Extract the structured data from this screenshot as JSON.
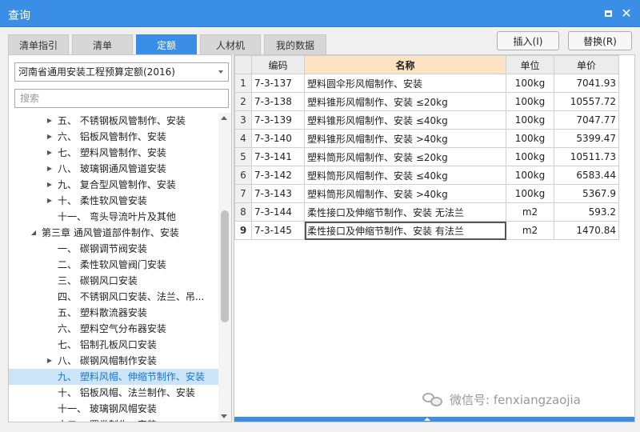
{
  "window": {
    "title": "查询"
  },
  "tabs": [
    {
      "label": "清单指引",
      "active": false
    },
    {
      "label": "清单",
      "active": false
    },
    {
      "label": "定额",
      "active": true
    },
    {
      "label": "人材机",
      "active": false
    },
    {
      "label": "我的数据",
      "active": false
    }
  ],
  "toolbar": {
    "insert_label": "插入(I)",
    "replace_label": "替换(R)"
  },
  "library": {
    "selected": "河南省通用安装工程预算定额(2016)"
  },
  "search": {
    "placeholder": "搜索",
    "value": ""
  },
  "tree": [
    {
      "label": "五、 不锈钢板风管制作、安装",
      "expander": true,
      "level": 3
    },
    {
      "label": "六、 铝板风管制作、安装",
      "expander": true,
      "level": 3
    },
    {
      "label": "七、 塑料风管制作、安装",
      "expander": true,
      "level": 3
    },
    {
      "label": "八、 玻璃钢通风管道安装",
      "expander": true,
      "level": 3
    },
    {
      "label": "九、 复合型风管制作、安装",
      "expander": true,
      "level": 3
    },
    {
      "label": "十、 柔性软风管安装",
      "expander": true,
      "level": 3
    },
    {
      "label": "十一、 弯头导流叶片及其他",
      "expander": false,
      "level": 3
    },
    {
      "label": "第三章 通风管道部件制作、安装",
      "expander": true,
      "expanded": true,
      "level": 2
    },
    {
      "label": "一、 碳钢调节阀安装",
      "expander": false,
      "level": 3
    },
    {
      "label": "二、 柔性软风管阀门安装",
      "expander": false,
      "level": 3
    },
    {
      "label": "三、 碳钢风口安装",
      "expander": false,
      "level": 3
    },
    {
      "label": "四、 不锈钢风口安装、法兰、吊...",
      "expander": false,
      "level": 3
    },
    {
      "label": "五、 塑料散流器安装",
      "expander": false,
      "level": 3
    },
    {
      "label": "六、 塑料空气分布器安装",
      "expander": false,
      "level": 3
    },
    {
      "label": "七、 铝制孔板风口安装",
      "expander": false,
      "level": 3
    },
    {
      "label": "八、 碳钢风帽制作安装",
      "expander": true,
      "level": 3
    },
    {
      "label": "九、 塑料风帽、伸缩节制作、安装",
      "expander": false,
      "level": 3,
      "selected": true
    },
    {
      "label": "十、 铝板风帽、法兰制作、安装",
      "expander": false,
      "level": 3
    },
    {
      "label": "十一、 玻璃钢风帽安装",
      "expander": false,
      "level": 3
    },
    {
      "label": "十二、 罩类制作、安装",
      "expander": false,
      "level": 3
    }
  ],
  "grid": {
    "columns": [
      "",
      "编码",
      "名称",
      "单位",
      "单价"
    ],
    "rows": [
      {
        "n": "1",
        "code": "7-3-137",
        "name": "塑料圆伞形风帽制作、安装",
        "unit": "100kg",
        "price": "7041.93"
      },
      {
        "n": "2",
        "code": "7-3-138",
        "name": "塑料锥形风帽制作、安装 ≤20kg",
        "unit": "100kg",
        "price": "10557.72"
      },
      {
        "n": "3",
        "code": "7-3-139",
        "name": "塑料锥形风帽制作、安装 ≤40kg",
        "unit": "100kg",
        "price": "7047.77"
      },
      {
        "n": "4",
        "code": "7-3-140",
        "name": "塑料锥形风帽制作、安装 >40kg",
        "unit": "100kg",
        "price": "5399.47"
      },
      {
        "n": "5",
        "code": "7-3-141",
        "name": "塑料筒形风帽制作、安装 ≤20kg",
        "unit": "100kg",
        "price": "10511.73"
      },
      {
        "n": "6",
        "code": "7-3-142",
        "name": "塑料筒形风帽制作、安装 ≤40kg",
        "unit": "100kg",
        "price": "6583.44"
      },
      {
        "n": "7",
        "code": "7-3-143",
        "name": "塑料筒形风帽制作、安装 >40kg",
        "unit": "100kg",
        "price": "5367.9"
      },
      {
        "n": "8",
        "code": "7-3-144",
        "name": "柔性接口及伸缩节制作、安装 无法兰",
        "unit": "m2",
        "price": "593.2"
      },
      {
        "n": "9",
        "code": "7-3-145",
        "name": "柔性接口及伸缩节制作、安装 有法兰",
        "unit": "m2",
        "price": "1470.84",
        "selected": true
      }
    ]
  },
  "watermark": {
    "text": "微信号: fenxiangzaojia"
  },
  "colors": {
    "accent": "#3a8ee6",
    "name_header": "#fbe3c4",
    "tree_selected": "#cce4f7"
  }
}
